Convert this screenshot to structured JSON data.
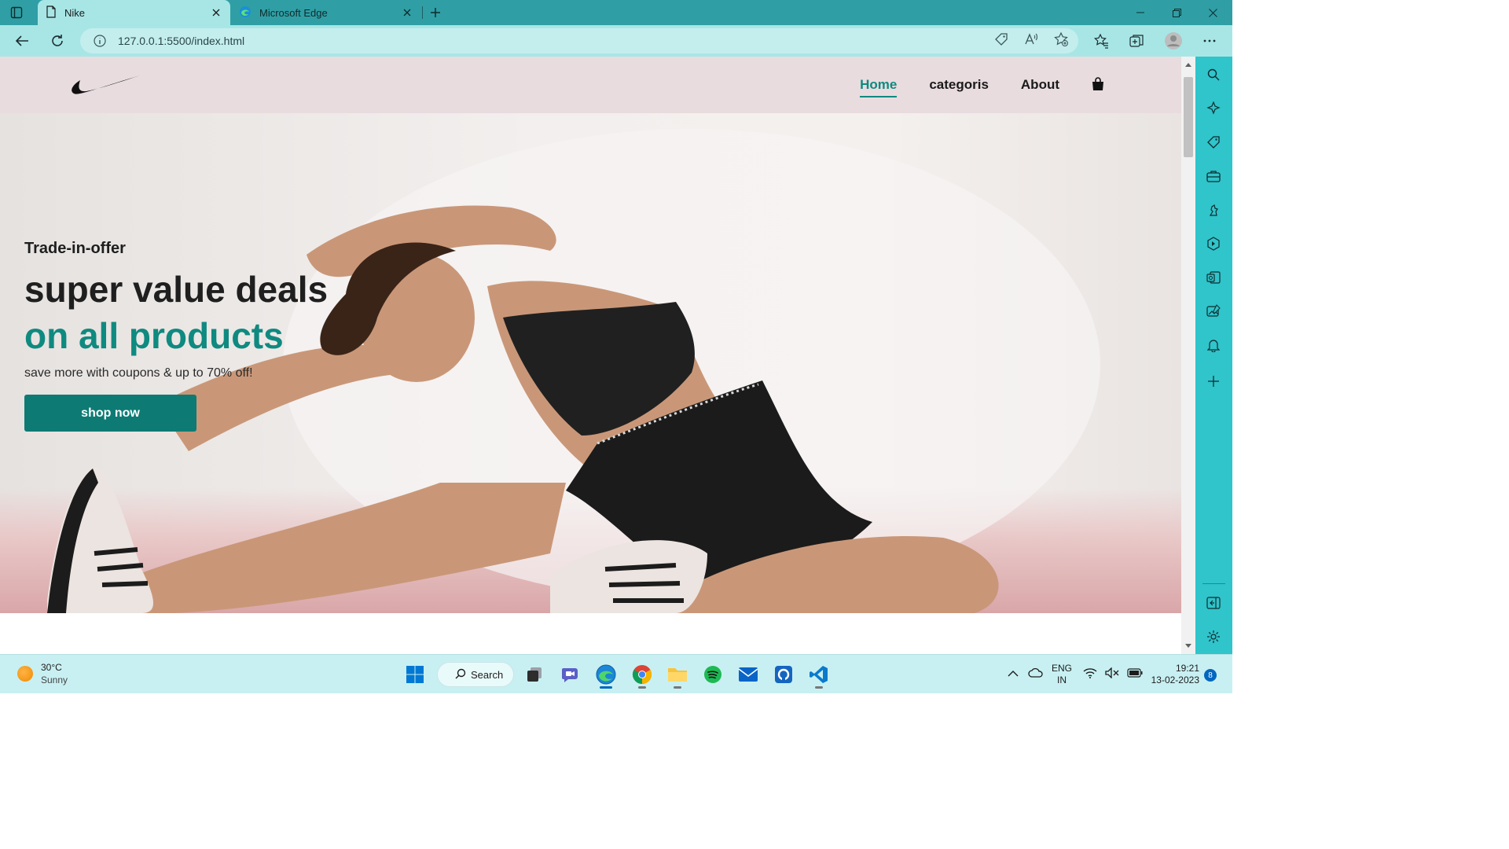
{
  "browser": {
    "tabs": [
      {
        "title": "Nike",
        "active": true
      },
      {
        "title": "Microsoft Edge",
        "active": false
      }
    ],
    "url": "127.0.0.1:5500/index.html"
  },
  "page": {
    "nav": {
      "items": [
        {
          "label": "Home",
          "active": true
        },
        {
          "label": "categoris",
          "active": false
        },
        {
          "label": "About",
          "active": false
        }
      ]
    },
    "hero": {
      "kicker": "Trade-in-offer",
      "headline": "super value deals",
      "highlight": "on all products",
      "subtext": "save more with coupons & up to 70% off!",
      "cta": "shop now"
    }
  },
  "taskbar": {
    "weather": {
      "temp": "30°C",
      "condition": "Sunny"
    },
    "search_label": "Search",
    "language": {
      "lang": "ENG",
      "region": "IN"
    },
    "time": "19:21",
    "date": "13-02-2023",
    "notifications": "8"
  },
  "colors": {
    "accent": "#0f8a80",
    "button": "#0d7b74",
    "header_bg": "#e8dcdf",
    "browser_chrome": "#2f9fa5",
    "sidebar": "#30c4cb"
  }
}
